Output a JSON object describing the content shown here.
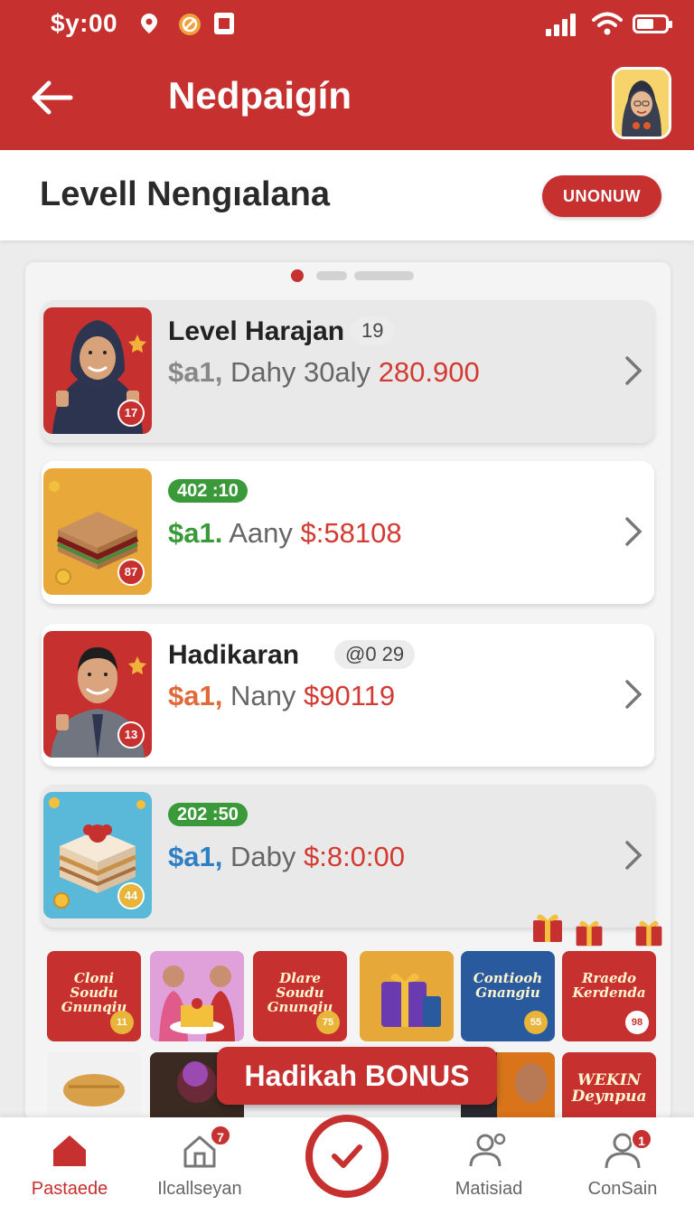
{
  "status_bar": {
    "time": "$y:00"
  },
  "header": {
    "title": "Nedpaigín"
  },
  "subheader": {
    "heading": "Levell Nengıalana",
    "button_label": "UNONUW"
  },
  "carousel": {
    "pages": 3,
    "active": 0
  },
  "cards": [
    {
      "name": "Level Harajan",
      "tag": "19",
      "sal": "$a1,",
      "mid": "Dahy 30aly",
      "amount": "280.900",
      "sal_color": "#888888",
      "badge": "17",
      "badge_color": "#c6302f"
    },
    {
      "greentag": "402 :10",
      "sal": "$a1.",
      "mid": "Aany",
      "amount": "$:58108",
      "sal_color": "#3a9a3a",
      "badge": "87",
      "badge_color": "#c6302f"
    },
    {
      "name": "Hadikaran",
      "tag": "@0  29",
      "sal": "$a1,",
      "mid": "Nany",
      "amount": "$90119",
      "sal_color": "#e06a3a",
      "badge": "13",
      "badge_color": "#c6302f"
    },
    {
      "greentag": "202 :50",
      "sal": "$a1,",
      "mid": "Daby",
      "amount": "$:8:0:00",
      "sal_color": "#2f7fc4",
      "badge": "44",
      "badge_color": "#e8b43a"
    }
  ],
  "promos_row1": [
    {
      "text": "Cloni Soudu Gnunqiu",
      "num": "11",
      "bg": "#c6302f"
    },
    {
      "text": "",
      "num": "",
      "bg": "#d97ad6"
    },
    {
      "text": "Dlare Soudu Gnunqiu",
      "num": "75",
      "bg": "#c6302f"
    },
    {
      "text": "",
      "num": "",
      "bg": "#e6a838"
    },
    {
      "text": "Contiooh Gnangiu",
      "num": "55",
      "bg": "#2a5a9e"
    },
    {
      "text": "Rraedo Kerdenda",
      "num": "98",
      "bg": "#c6302f"
    }
  ],
  "promos_row2": [
    {
      "text": "",
      "bg": "#f1f1f1"
    },
    {
      "text": "",
      "bg": "#4a3a2a"
    },
    {
      "text": "",
      "bg": "#d9741a"
    },
    {
      "text": "",
      "bg": "#3a3030"
    },
    {
      "text": "",
      "bg": "#3a3a44"
    },
    {
      "text": "WEKIN Deynpua",
      "bg": "#c6302f"
    }
  ],
  "bonus_label": "Hadikah BONUS",
  "nav": [
    {
      "label": "Pastaede",
      "icon": "home-icon",
      "active": true,
      "badge": ""
    },
    {
      "label": "Ilcallseyan",
      "icon": "home-outline-icon",
      "active": false,
      "badge": "7"
    },
    {
      "label": "Matisiad",
      "icon": "users-icon",
      "active": false,
      "badge": ""
    },
    {
      "label": "ConSain",
      "icon": "user-icon",
      "active": false,
      "badge": "1"
    }
  ],
  "colors": {
    "brand": "#c6302f",
    "green": "#3a9a3a"
  }
}
